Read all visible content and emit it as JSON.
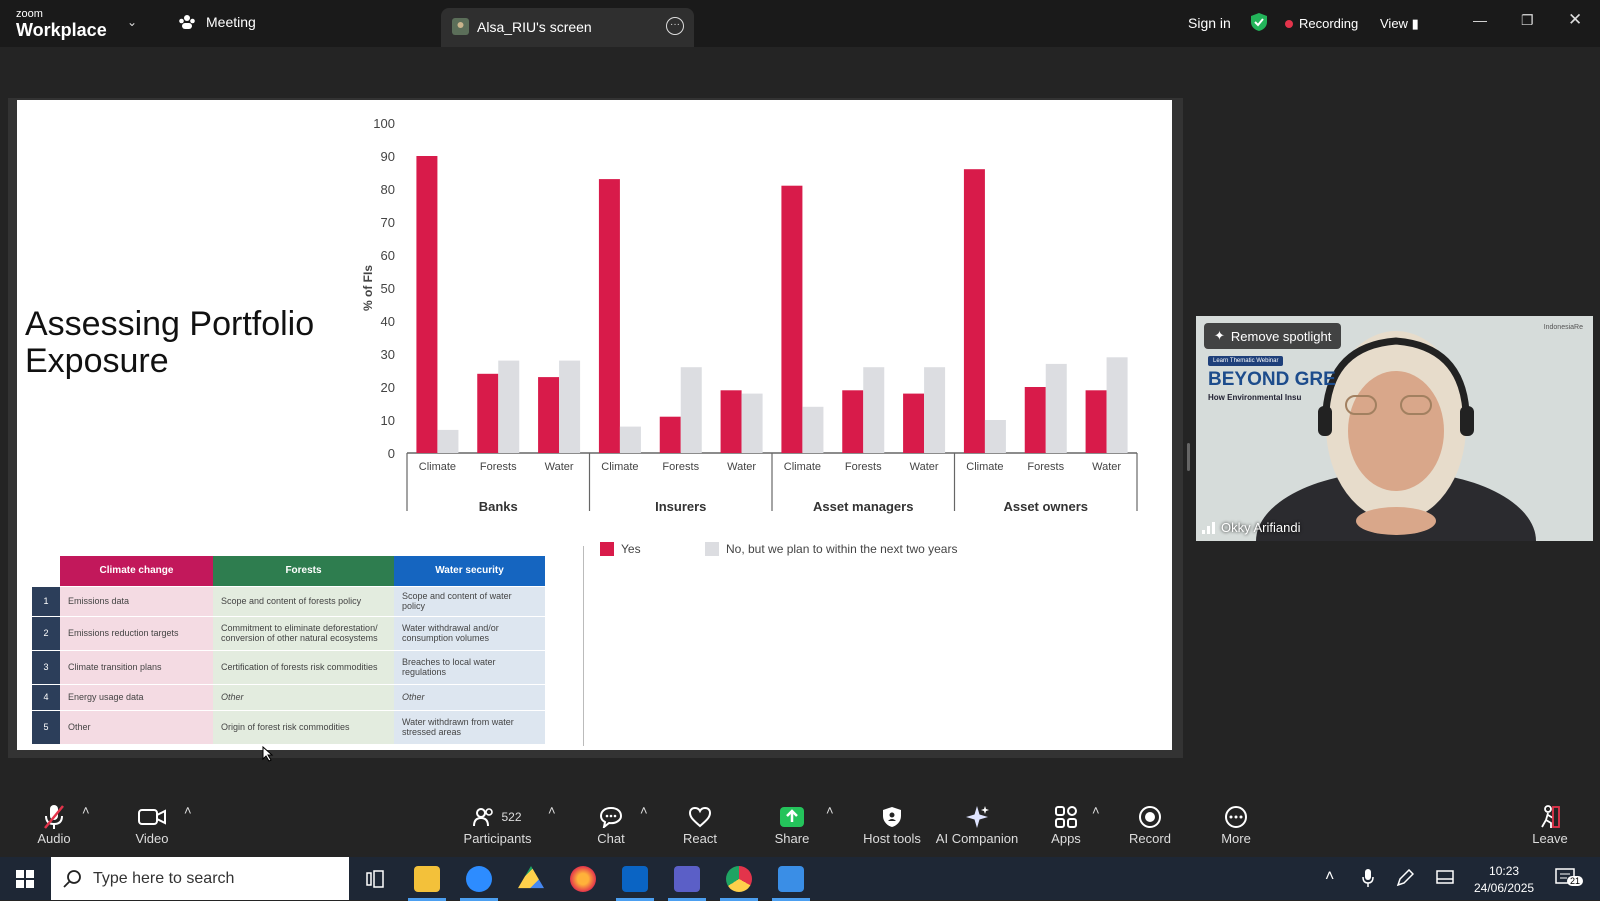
{
  "topbar": {
    "brand_small": "zoom",
    "brand_big": "Workplace",
    "meeting_tab": "Meeting",
    "screen_tab": "Alsa_RIU's screen",
    "sign_in": "Sign in",
    "recording": "Recording",
    "view": "View"
  },
  "slide": {
    "title": "Assessing Portfolio Exposure",
    "legend_yes": "Yes",
    "legend_no": "No, but we plan to within the next two years",
    "table": {
      "headers": [
        "Climate change",
        "Forests",
        "Water security"
      ],
      "rows": [
        {
          "n": "1",
          "cc": "Emissions data",
          "fo": "Scope and content of forests policy",
          "wa": "Scope and content of water policy"
        },
        {
          "n": "2",
          "cc": "Emissions reduction targets",
          "fo": "Commitment to eliminate deforestation/ conversion of other natural ecosystems",
          "wa": "Water withdrawal and/or consumption volumes"
        },
        {
          "n": "3",
          "cc": "Climate transition plans",
          "fo": "Certification of forests risk commodities",
          "wa": "Breaches to local water regulations"
        },
        {
          "n": "4",
          "cc": "Energy usage data",
          "fo": "Other",
          "wa": "Other"
        },
        {
          "n": "5",
          "cc": "Other",
          "fo": "Origin of forest risk commodities",
          "wa": "Water withdrawn from water stressed areas"
        }
      ],
      "header_colors": [
        "#c2185b",
        "#2e7d4f",
        "#1565c0"
      ]
    }
  },
  "chart_data": {
    "type": "bar",
    "ylabel": "% of FIs",
    "ylim": [
      0,
      100
    ],
    "yticks": [
      0,
      10,
      20,
      30,
      40,
      50,
      60,
      70,
      80,
      90,
      100
    ],
    "groups": [
      "Banks",
      "Insurers",
      "Asset managers",
      "Asset owners"
    ],
    "categories": [
      "Climate",
      "Forests",
      "Water"
    ],
    "series": [
      {
        "name": "Yes",
        "color": "#d81b4a",
        "values": [
          90,
          24,
          23,
          83,
          11,
          19,
          81,
          19,
          18,
          86,
          20,
          19
        ]
      },
      {
        "name": "No, but we plan to within the next two years",
        "color": "#dcdde1",
        "values": [
          7,
          28,
          28,
          8,
          26,
          18,
          14,
          26,
          26,
          10,
          27,
          29
        ]
      }
    ]
  },
  "video": {
    "spotlight": "Remove spotlight",
    "banner_tag": "Learn Thematic Webinar",
    "banner_big": "BEYOND GRE",
    "banner_sub": "How Environmental Insu",
    "name": "Okky Arifiandi",
    "logo": "IndonesiaRe"
  },
  "toolbar": {
    "audio": "Audio",
    "video": "Video",
    "participants": "Participants",
    "participants_count": "522",
    "chat": "Chat",
    "react": "React",
    "share": "Share",
    "host_tools": "Host tools",
    "ai_companion": "AI Companion",
    "apps": "Apps",
    "record": "Record",
    "more": "More",
    "leave": "Leave"
  },
  "taskbar": {
    "search_placeholder": "Type here to search",
    "time": "10:23",
    "date": "24/06/2025",
    "notif_count": "21"
  }
}
